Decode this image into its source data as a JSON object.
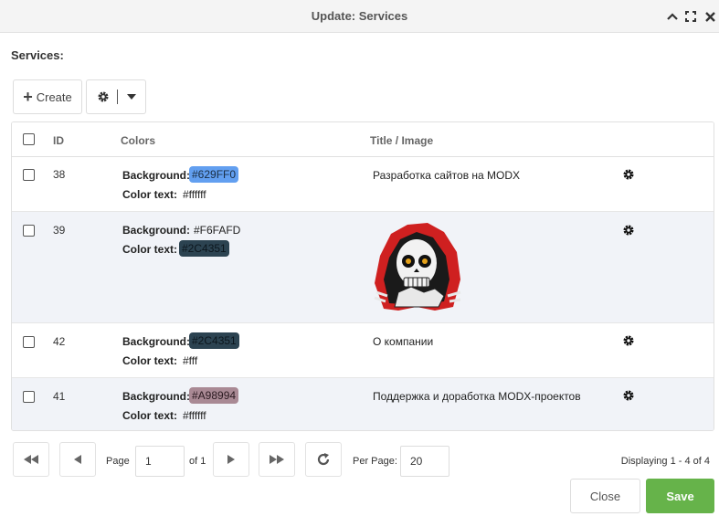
{
  "window": {
    "title": "Update: Services",
    "icons": [
      "chevron-up-icon",
      "maximize-icon",
      "close-icon"
    ]
  },
  "section_label": "Services:",
  "toolbar": {
    "create_label": "Create",
    "icons": [
      "plus-icon",
      "gear-icon",
      "caret-down-icon"
    ]
  },
  "grid": {
    "columns": {
      "id": "ID",
      "colors": "Colors",
      "title": "Title / Image"
    },
    "bg_label": "Background:",
    "text_label": "Color text:",
    "rows": [
      {
        "id": "38",
        "background": "#629FF0",
        "color_text": "#ffffff",
        "title": "Разработка сайтов на MODX"
      },
      {
        "id": "39",
        "background": "#F6FAFD",
        "color_text": "#2C4351",
        "title": "",
        "image": "skull-image"
      },
      {
        "id": "42",
        "background": "#2C4351",
        "color_text": "#fff",
        "title": "О компании"
      },
      {
        "id": "41",
        "background": "#A98994",
        "color_text": "#ffffff",
        "title": "Поддержка и доработка MODX-проектов"
      }
    ]
  },
  "paging": {
    "page_label": "Page",
    "page_value": "1",
    "of_label": "of 1",
    "per_page_label": "Per Page:",
    "per_page_value": "20",
    "displaying": "Displaying 1 - 4 of 4"
  },
  "footer": {
    "close_label": "Close",
    "save_label": "Save"
  },
  "colors": {
    "save": "#66b34a",
    "chip_38_bg": "#629FF0",
    "chip_39_text": "#2C4351",
    "chip_42_bg": "#2C4351",
    "chip_41_bg": "#A98994"
  }
}
